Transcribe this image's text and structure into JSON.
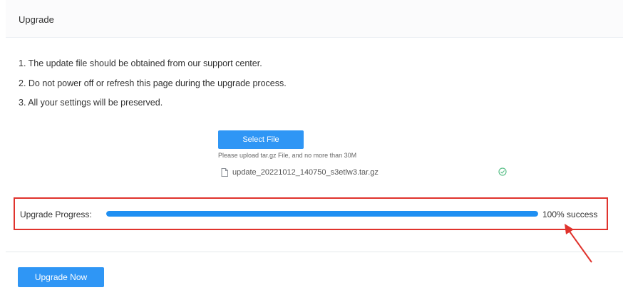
{
  "header": {
    "title": "Upgrade"
  },
  "notes": [
    "1. The update file should be obtained from our support center.",
    "2. Do not power off or refresh this page during the upgrade process.",
    "3. All your settings will be preserved."
  ],
  "upload": {
    "select_label": "Select File",
    "hint": "Please upload tar.gz File, and no more than 30M",
    "file_name": "update_20221012_140750_s3etlw3.tar.gz",
    "file_icon": "document-icon",
    "status_icon": "check-circle-icon"
  },
  "progress": {
    "label": "Upgrade Progress:",
    "value": 100,
    "status": "100% success"
  },
  "actions": {
    "upgrade_label": "Upgrade Now"
  },
  "colors": {
    "primary": "#2f96f5",
    "progress": "#1f8ff2",
    "highlight": "#e0332d",
    "success": "#5cc08a"
  }
}
